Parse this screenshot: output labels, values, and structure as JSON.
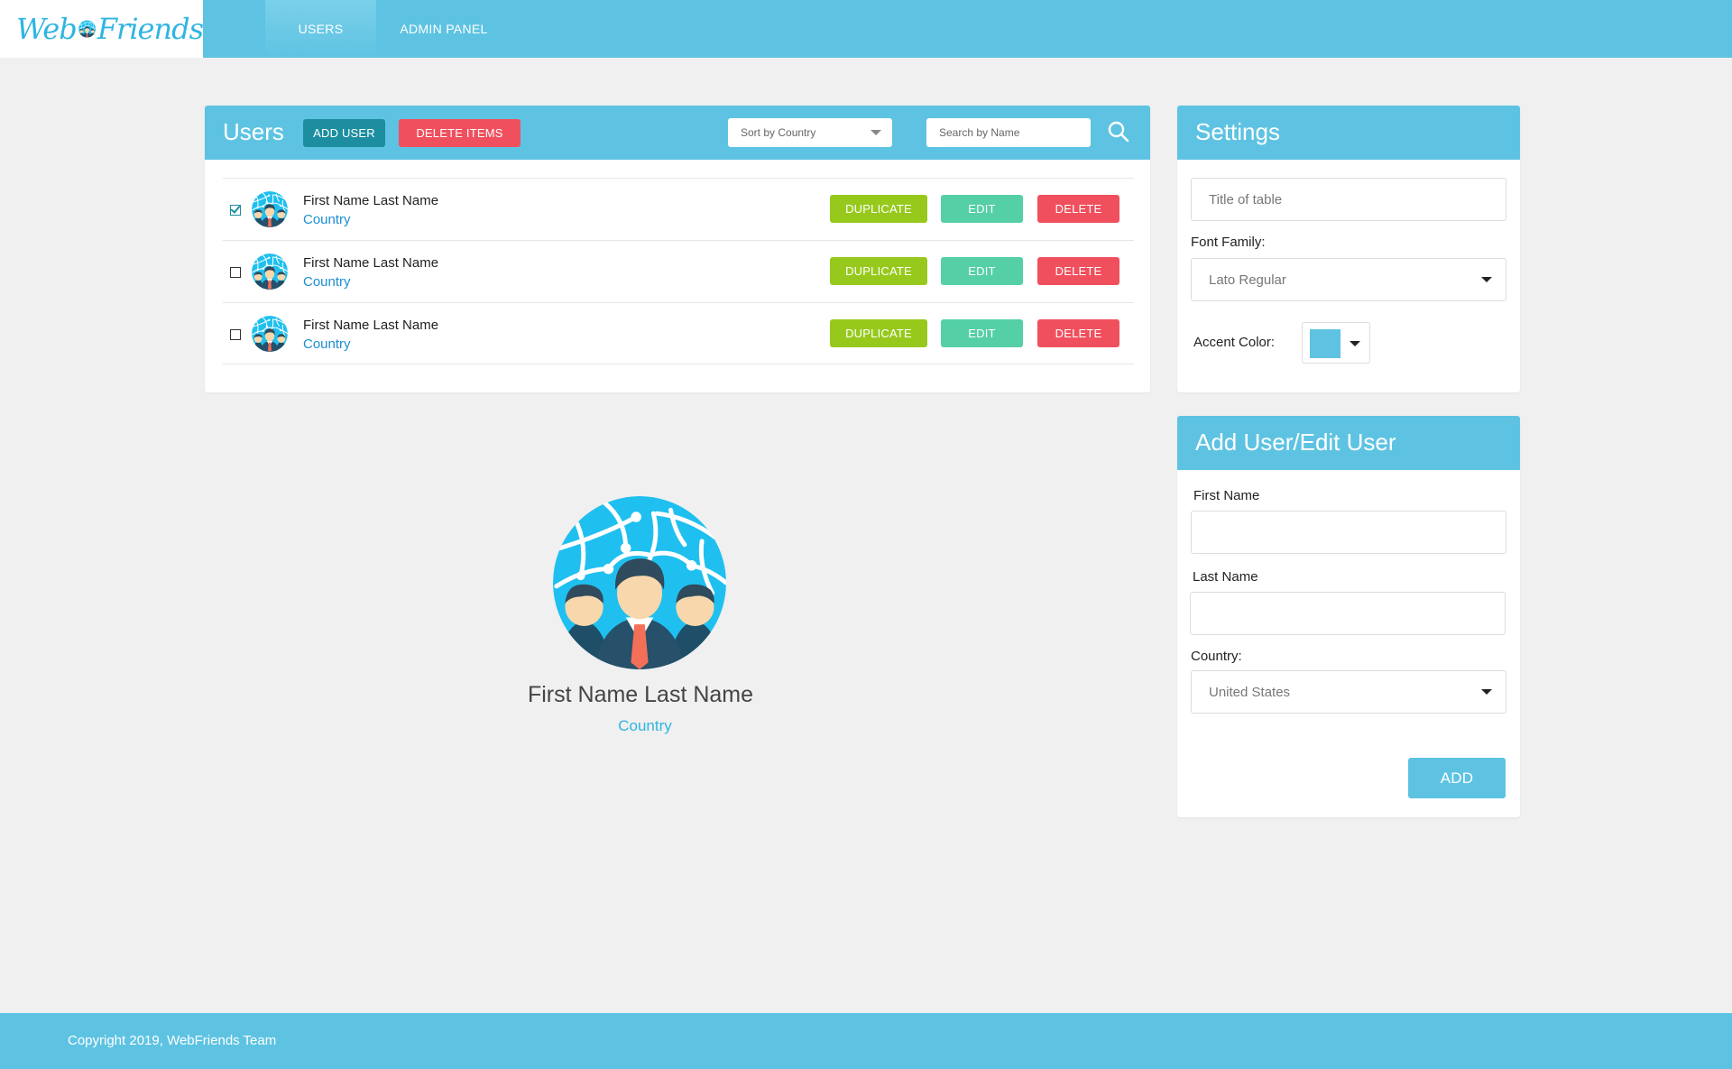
{
  "brand": {
    "left_word": "Web",
    "right_word": "Friends"
  },
  "nav": {
    "tabs": [
      "USERS",
      "ADMIN PANEL"
    ],
    "active": "USERS"
  },
  "users_panel": {
    "title": "Users",
    "add_user_label": "ADD USER",
    "delete_items_label": "DELETE ITEMS",
    "sort": {
      "value": "Sort by Country"
    },
    "search": {
      "placeholder": "Search by Name"
    },
    "rows": [
      {
        "name": "First Name Last Name",
        "country": "Country",
        "checked": true,
        "duplicate": "DUPLICATE",
        "edit": "EDIT",
        "delete": "DELETE"
      },
      {
        "name": "First Name Last Name",
        "country": "Country",
        "checked": false,
        "duplicate": "DUPLICATE",
        "edit": "EDIT",
        "delete": "DELETE"
      },
      {
        "name": "First Name Last Name",
        "country": "Country",
        "checked": false,
        "duplicate": "DUPLICATE",
        "edit": "EDIT",
        "delete": "DELETE"
      }
    ]
  },
  "profile": {
    "name": "First Name Last Name",
    "country": "Country"
  },
  "settings": {
    "title": "Settings",
    "table_title_placeholder": "Title of table",
    "font_family_label": "Font Family:",
    "font_family_value": "Lato Regular",
    "accent_color_label": "Accent Color:",
    "accent_color": "#5ec3e2"
  },
  "add_user": {
    "title": "Add User/Edit User",
    "first_name_label": "First Name",
    "last_name_label": "Last Name",
    "country_label": "Country:",
    "country_value": "United States",
    "add_label": "ADD"
  },
  "footer": {
    "text": "Copyright 2019, WebFriends Team"
  },
  "colors": {
    "accent": "#5ec3e2",
    "teal": "#1c8ea0",
    "red": "#f0505e",
    "green": "#97c91d",
    "mint": "#55cfa5",
    "link": "#1b8fd0"
  }
}
